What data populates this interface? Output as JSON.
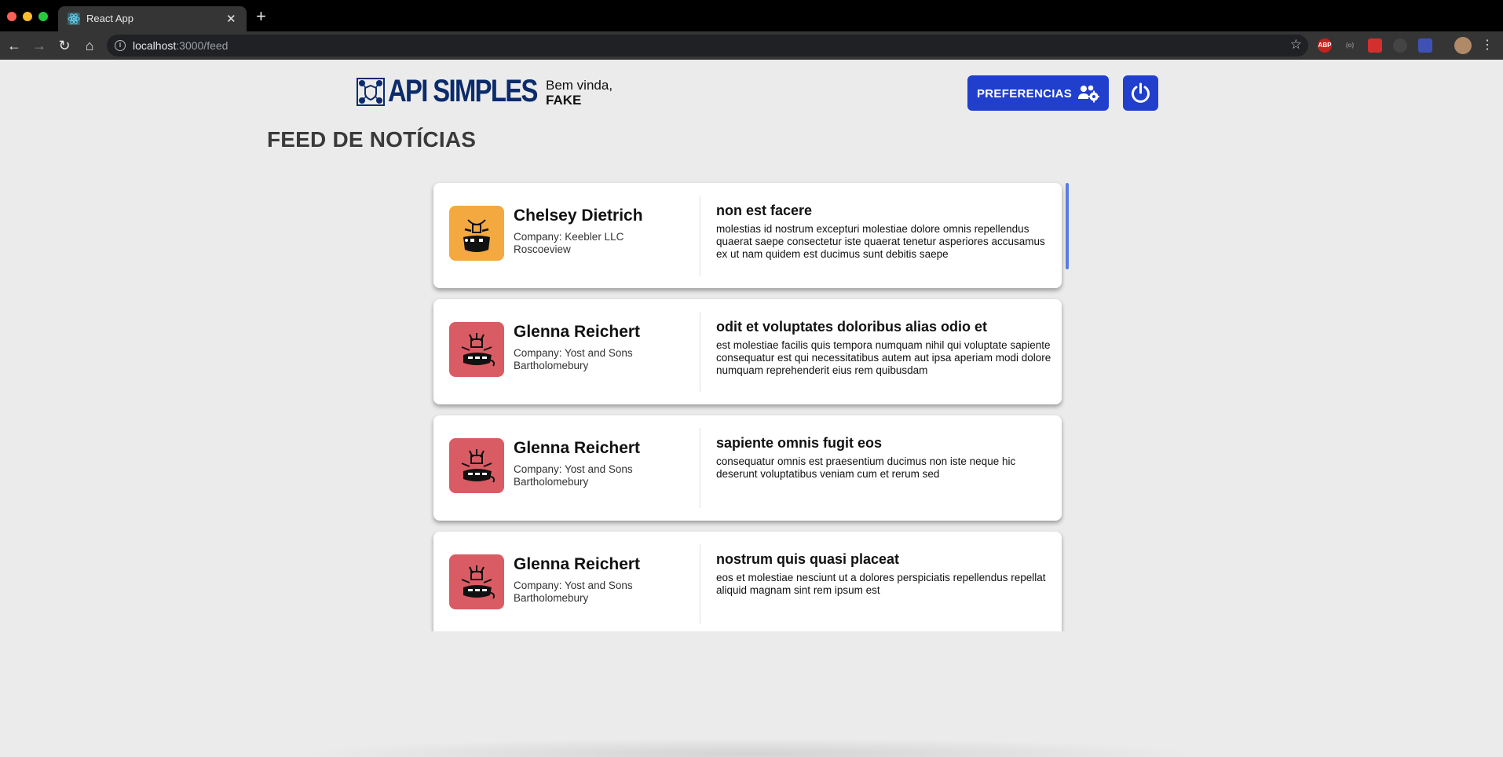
{
  "browser": {
    "tab_title": "React App",
    "url_host": "localhost",
    "url_path": ":3000/feed",
    "extensions": [
      "ABP",
      "(o)",
      "",
      "",
      "",
      ""
    ]
  },
  "header": {
    "logo_text": "API SIMPLES",
    "greeting": "Bem vinda,",
    "user_name": "FAKE",
    "preferences_label": "PREFERENCIAS"
  },
  "page": {
    "title": "FEED DE NOTÍCIAS"
  },
  "feed": {
    "posts": [
      {
        "author": "Chelsey Dietrich",
        "company": "Company: Keebler LLC",
        "city": "Roscoeview",
        "avatar_color": "#f3a93f",
        "title": "non est facere",
        "body": "molestias id nostrum excepturi molestiae dolore omnis repellendus quaerat saepe consectetur iste quaerat tenetur asperiores accusamus ex ut nam quidem est ducimus sunt debitis saepe"
      },
      {
        "author": "Glenna Reichert",
        "company": "Company: Yost and Sons",
        "city": "Bartholomebury",
        "avatar_color": "#d95c64",
        "title": "odit et voluptates doloribus alias odio et",
        "body": "est molestiae facilis quis tempora numquam nihil qui voluptate sapiente consequatur est qui necessitatibus autem aut ipsa aperiam modi dolore numquam reprehenderit eius rem quibusdam"
      },
      {
        "author": "Glenna Reichert",
        "company": "Company: Yost and Sons",
        "city": "Bartholomebury",
        "avatar_color": "#d95c64",
        "title": "sapiente omnis fugit eos",
        "body": "consequatur omnis est praesentium ducimus non iste neque hic deserunt voluptatibus veniam cum et rerum sed"
      },
      {
        "author": "Glenna Reichert",
        "company": "Company: Yost and Sons",
        "city": "Bartholomebury",
        "avatar_color": "#d95c64",
        "title": "nostrum quis quasi placeat",
        "body": "eos et molestiae nesciunt ut a dolores perspiciatis repellendus repellat aliquid magnam sint rem ipsum est"
      }
    ]
  },
  "colors": {
    "brand": "#1f3fcc",
    "logo": "#0b2b6b",
    "background": "#ebebeb"
  },
  "icons": [
    "react-favicon",
    "info-icon",
    "star-icon",
    "back-icon",
    "forward-icon",
    "reload-icon",
    "home-icon",
    "logo-network-icon",
    "users-gear-icon",
    "power-icon",
    "monster-avatar-icon"
  ]
}
